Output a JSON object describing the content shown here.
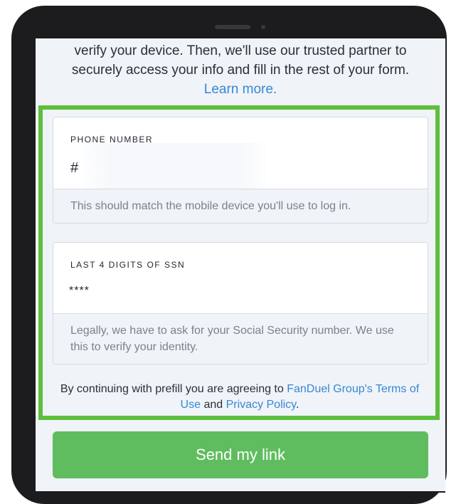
{
  "intro": {
    "line1": "verify your device. Then, we'll use our trusted partner to",
    "line2": "securely access your info and fill in the rest of your form.",
    "learn_more": "Learn more."
  },
  "phone_field": {
    "label": "PHONE NUMBER",
    "prefix": "#",
    "value": "",
    "help": "This should match the mobile device you'll use to log in."
  },
  "ssn_field": {
    "label": "LAST 4 DIGITS OF SSN",
    "value": "****",
    "help": "Legally, we have to ask for your Social Security number. We use this to verify your identity."
  },
  "terms": {
    "before": "By continuing with prefill you are agreeing to ",
    "terms_link": "FanDuel Group's Terms of Use",
    "middle": " and ",
    "privacy_link": "Privacy Policy",
    "after": "."
  },
  "send_button": {
    "label": "Send my link"
  },
  "colors": {
    "highlight": "#5dbf3d",
    "button": "#5fbd5f",
    "link": "#3688d6"
  }
}
